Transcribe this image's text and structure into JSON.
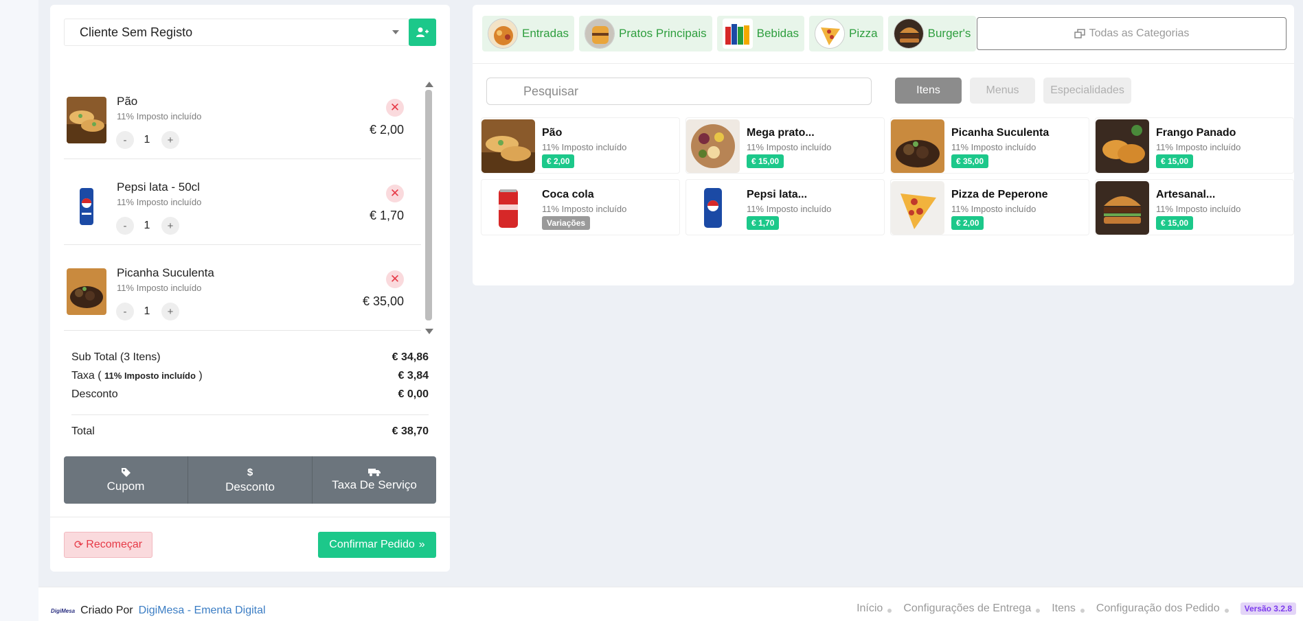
{
  "cart": {
    "customer": "Cliente Sem Registo",
    "items": [
      {
        "name": "Pão",
        "tax": "11% Imposto incluído",
        "qty": "1",
        "price": "€ 2,00"
      },
      {
        "name": "Pepsi lata - 50cl",
        "tax": "11% Imposto incluído",
        "qty": "1",
        "price": "€ 1,70"
      },
      {
        "name": "Picanha Suculenta",
        "tax": "11% Imposto incluído",
        "qty": "1",
        "price": "€ 35,00"
      }
    ],
    "totals": {
      "subtotal_label": "Sub Total (3 Itens)",
      "subtotal": "€ 34,86",
      "tax_label_pre": "Taxa (",
      "tax_note": "11% Imposto incluído",
      "tax_label_post": ")",
      "tax": "€ 3,84",
      "discount_label": "Desconto",
      "discount": "€ 0,00",
      "total_label": "Total",
      "total": "€ 38,70"
    },
    "actions": {
      "coupon": "Cupom",
      "discount": "Desconto",
      "service_fee": "Taxa De Serviço"
    },
    "restart": "Recomeçar",
    "confirm": "Confirmar Pedido"
  },
  "catalog": {
    "categories": [
      {
        "label": "Entradas"
      },
      {
        "label": "Pratos Principais"
      },
      {
        "label": "Bebidas"
      },
      {
        "label": "Pizza"
      },
      {
        "label": "Burger's"
      }
    ],
    "all_categories": "Todas as Categorias",
    "search": {
      "placeholder": "Pesquisar",
      "value": ""
    },
    "tabs": [
      "Itens",
      "Menus",
      "Especialidades"
    ],
    "products": [
      {
        "name": "Pão",
        "tax": "11% Imposto incluído",
        "badge": "€ 2,00"
      },
      {
        "name": "Mega prato...",
        "tax": "11% Imposto incluído",
        "badge": "€ 15,00"
      },
      {
        "name": "Picanha Suculenta",
        "tax": "11% Imposto incluído",
        "badge": "€ 35,00"
      },
      {
        "name": "Frango Panado",
        "tax": "11% Imposto incluído",
        "badge": "€ 15,00"
      },
      {
        "name": "Coca cola",
        "tax": "11% Imposto incluído",
        "badge": "Variações"
      },
      {
        "name": "Pepsi lata...",
        "tax": "11% Imposto incluído",
        "badge": "€ 1,70"
      },
      {
        "name": "Pizza de Peperone",
        "tax": "11% Imposto incluído",
        "badge": "€ 2,00"
      },
      {
        "name": "Artesanal...",
        "tax": "11% Imposto incluído",
        "badge": "€ 15,00"
      }
    ]
  },
  "footer": {
    "logo": "DigiMesa",
    "created_by": "Criado Por",
    "brand_link": "DigiMesa - Ementa Digital",
    "nav": [
      "Início",
      "Configurações de Entrega",
      "Itens",
      "Configuração dos Pedido"
    ],
    "version": "Versão 3.2.8"
  },
  "colors": {
    "accent": "#1cc88a",
    "category_bg": "#e8f5ea",
    "category_text": "#2e9e3e",
    "danger": "#e63946",
    "action_group": "#6c757d"
  }
}
